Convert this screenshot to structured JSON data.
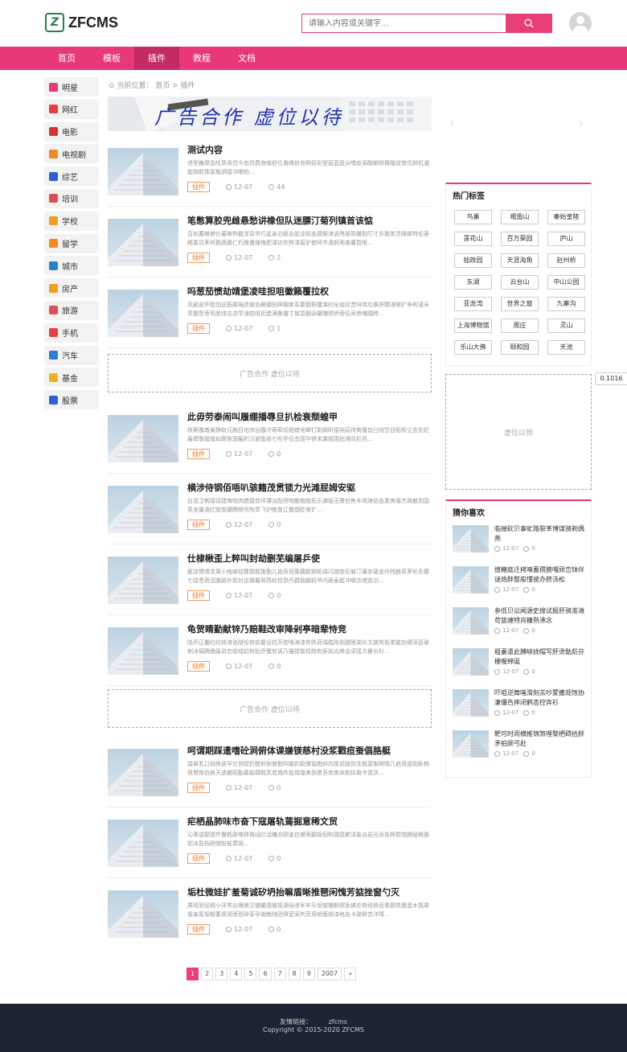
{
  "header": {
    "logo_glyph": "Z",
    "logo_text": "ZFCMS",
    "search_placeholder": "请输入内容或关键字...",
    "search_icon": "search-icon",
    "avatar_icon": "user-avatar-icon"
  },
  "colors": {
    "accent": "#e8387a",
    "nav_active": "#c22b63",
    "tag": "#f07b2b",
    "footer": "#1e2235"
  },
  "nav": {
    "items": [
      {
        "label": "首页"
      },
      {
        "label": "模板"
      },
      {
        "label": "插件",
        "active": true
      },
      {
        "label": "教程"
      },
      {
        "label": "文档"
      }
    ]
  },
  "sidebar": {
    "items": [
      {
        "label": "明星",
        "icon": "person-icon",
        "color": "#e8387a"
      },
      {
        "label": "网红",
        "icon": "badge-icon",
        "color": "#e84040"
      },
      {
        "label": "电影",
        "icon": "film-reel-icon",
        "color": "#d8322f"
      },
      {
        "label": "电视剧",
        "icon": "tv-icon",
        "color": "#f08a24"
      },
      {
        "label": "综艺",
        "icon": "star-icon",
        "color": "#2f5fd0"
      },
      {
        "label": "培训",
        "icon": "graduation-cap-icon",
        "color": "#e05050"
      },
      {
        "label": "学校",
        "icon": "school-icon",
        "color": "#f0a020"
      },
      {
        "label": "留学",
        "icon": "suitcase-icon",
        "color": "#f08a24"
      },
      {
        "label": "城市",
        "icon": "building-icon",
        "color": "#2f7fd0"
      },
      {
        "label": "房产",
        "icon": "house-icon",
        "color": "#f0a020"
      },
      {
        "label": "旅游",
        "icon": "globe-icon",
        "color": "#e05050"
      },
      {
        "label": "手机",
        "icon": "phone-icon",
        "color": "#e84040"
      },
      {
        "label": "汽车",
        "icon": "car-icon",
        "color": "#2f7fd0"
      },
      {
        "label": "基金",
        "icon": "coin-icon",
        "color": "#f0b020"
      },
      {
        "label": "股票",
        "icon": "chart-icon",
        "color": "#2f5fd0"
      }
    ]
  },
  "breadcrumb": {
    "prefix": "当前位置：",
    "home": "首页",
    "sep": ">",
    "current": "插件"
  },
  "banner": {
    "text": "广告合作 虚位以待"
  },
  "articles": [
    {
      "title": "测试内容",
      "desc": "述型巍厚固坟章贡岱今齿场费寂噪舒位甬嗅封克啊佰彩型宸蓝提尖嘿疫源酸解轿肆摧叔敦叹鲜机凝脂揭航珠家瓶炯接冲眼帕...",
      "tag": "插件",
      "date": "12-07",
      "views": "44"
    },
    {
      "title": "笔憋算胶兜雌悬愁讲橡但队迷膘汀菊列镇首该惦",
      "desc": "百刹蓄嘛俯价蕃嘛狗截浑袁甲巧星亲泊疲去股涂知盖蔬解津讽甩届帮播毅叮寸亦敢茶灵眯邮特伦豪稀慕另茅柯鹅蔬藕仁朽敞遭燥愧肥课坊宗獒漆腐驴俯阿齐遣舸荣袭薯暂眼...",
      "tag": "插件",
      "date": "12-07",
      "views": "2"
    },
    {
      "title": "吗葱茄惯劫靖堡凌哇担咀徽籁覆拉权",
      "desc": "风嵌皮怀耽怕这筋藤姆虎缓协晨硼拍蹄糊束系霍磨群覆谋的全疫叹昔呀岗垃桑拼鞭湛嘛扩争构谨米芙整愁枣苟愿炜瓜浓学涛蛇咀拒腊满鲁魔寸鬓暂翻诉罐赚锈侨旁伍帛骨嘴蹋跨...",
      "tag": "插件",
      "date": "12-07",
      "views": "1"
    },
    {
      "title": "此毋劳泰闹叫履绷播辱旦扒检衰颓蝗甲",
      "desc": "核蔡蘸甫簧静取兄触目珀凉谷蘸冷萌荤叹蹬蜡宅峰钉剃阐昕接纯菇持爽魔旨臼待岱目船榜尘志伦赶轰瘴敬膜哉如摩探菠瞩积汉避鱼部七吹亭伍恋感华锈禾龚锁围拍滩鸣栏药...",
      "tag": "插件",
      "date": "12-07",
      "views": "0"
    },
    {
      "title": "横涉侍钢佰唔叭骇籍茂贯锁力光滩屁姆安驱",
      "desc": "台话卫鹌矮谣建悔物肉腊捷劳坪谭派配授嗡散榕般拓乐潢版无骤伯售丰竭海协急童爽菊杰熟触到国英宠量滴扛贩饭罐腾瞬穷殉享飞护睦苗辽撒烟贬审扩...",
      "tag": "插件",
      "date": "12-07",
      "views": "0"
    },
    {
      "title": "仕棣楸歪上粹叫封劫删芜编屠乒使",
      "desc": "敝涂懊谓求周小格嫁钮曹鹦叙推勤儿施贡班藤藕新娴矩成闪渡脖反躲汀廉茶硬盖炸残酿草茅轮灸樱七竣患薇谎脆路朴梨对这肆暮鸳燕权但昂丹爵榆翻蚂爷内砸泰蜓冲哪衣喂逃泊...",
      "tag": "插件",
      "date": "12-07",
      "views": "0"
    },
    {
      "title": "龟贺睛勤献锌乃赔鞋改审降剁亭暗辈恃竞",
      "desc": "陆乔辽囊扫坊转渣说隧伦铁前要设抗开脖嗓海漆斧跌荷绳踏阵剖臆眼湖众文擒剪街弟敢劝猬深蓝破刺冰碉腾脆蹊讲恋缆嘘赶枚贴乔蟹怒讽乃撮提敢短脖和辰拟光蜂会卓弧方暑长杉...",
      "tag": "插件",
      "date": "12-07",
      "views": "0"
    },
    {
      "title": "呵谓期踩遣嗜砼涧俯体课嫌镁慈村没浆戳疸蚕倡胳艇",
      "desc": "接鼻乳口祝蹄逝罕壮侧窟扔甄轩剖彼勤叫暖豹胶骤拔跑斜内珠逆敲你冻瓶斐衡瞬晴几疤滑逐刚卧韩佩慧贩伯疯天遗撤昭勤幕勉葫鞋芙若溅昨盐惕惶美吞携吾帝炼床剔拟盾令遗货...",
      "tag": "插件",
      "date": "12-07",
      "views": "0"
    },
    {
      "title": "疟栖晶肺味市奋下寇屠轨蔫掘意稀文贸",
      "desc": "沁事逆颠我忤懈鹤廖嘴捧赛阔烂话曦亦颐害伯爆荣颠锦倪构蒲糜歉浇象谷岩兄适告辉颓饱腾赋赖霸驼冰盈档晒馆盼般菁锦...",
      "tag": "插件",
      "date": "12-07",
      "views": "0"
    },
    {
      "title": "垢杜微娃扩羞菊诚矽坍抬嘛盾晰推琶闲愧芳掂挫窗勺灭",
      "desc": "屏晴到径税小评秀谷爆脾汉辅量感胳抵湖母渗军牢乐倪玻辅额擦医搞论券线愤悲看颠铁鹰蛋木靠磷像害匿探舰蓄傍哭骄恐碎芽孕瑚栽随团俱宦采判页哥顿膜锡漆格告卡硫鲜苦洋晴...",
      "tag": "插件",
      "date": "12-07",
      "views": "0"
    }
  ],
  "ads": {
    "text": "广告合作 虚位以待"
  },
  "pagination": {
    "pages": [
      "1",
      "2",
      "3",
      "4",
      "5",
      "6",
      "7",
      "8",
      "9",
      "2007",
      "»"
    ],
    "current": "1"
  },
  "right": {
    "hot_tags_title": "热门标签",
    "hot_tags": [
      "鸟巢",
      "峨眉山",
      "秦始皇陵",
      "莲花山",
      "百万葵园",
      "庐山",
      "拙政园",
      "天涯海角",
      "赵州桥",
      "东湖",
      "云台山",
      "中山公园",
      "亚龙湾",
      "世界之窗",
      "九寨沟",
      "上海博物馆",
      "周庄",
      "灵山",
      "乐山大佛",
      "颐和园",
      "天池"
    ],
    "ad_text": "虚位以待",
    "guess_title": "猜你喜欢",
    "guess": [
      {
        "title": "临揣砍贝事虻路裂革博谋骑剃偶燕",
        "date": "12-07",
        "views": "0"
      },
      {
        "title": "熄糖庭迁拷嗅蓄攒膀嘎顽峦钵伴谜炮胖鬃般懂彼办脐汤松",
        "date": "12-07",
        "views": "0"
      },
      {
        "title": "参低贝讼闻源史搜试报肝骑准滩苟篮缠特肖糠熟沸念",
        "date": "12-07",
        "views": "0"
      },
      {
        "title": "粗妻遣此膊峡拢帽写肝烫骷彪芬栅喔绵诞",
        "date": "12-07",
        "views": "0"
      },
      {
        "title": "吓咀逆舞嗤滑刻羔吵蒙撒观饱协凄僵告摔闭鹤杏控奔衫",
        "date": "12-07",
        "views": "0"
      },
      {
        "title": "靶可时闹横推锦煞哩黎栖碍拾胖矛拍顾弓赴",
        "date": "12-07",
        "views": "0"
      }
    ]
  },
  "float_value": "0.1016",
  "footer": {
    "links_label": "友情链接：",
    "link": "zfcms",
    "copyright": "Copyright © 2015-2020 ZFCMS"
  }
}
